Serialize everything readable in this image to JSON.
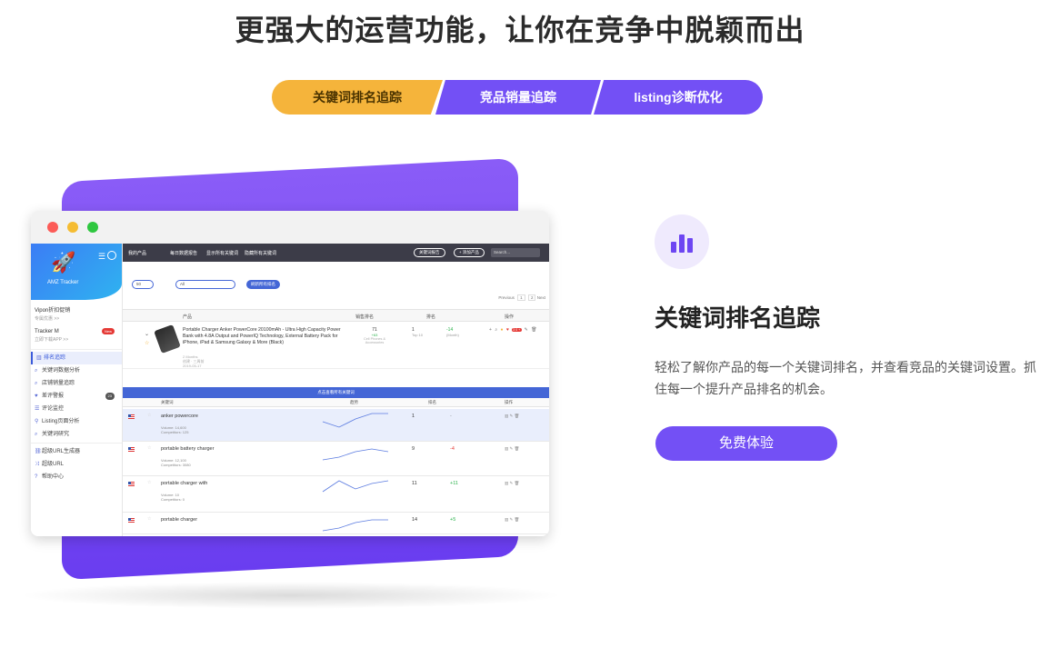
{
  "headline": "更强大的运营功能，让你在竞争中脱颖而出",
  "tabs": [
    {
      "label": "关键词排名追踪"
    },
    {
      "label": "竞品销量追踪"
    },
    {
      "label": "listing诊断优化"
    }
  ],
  "colors": {
    "accent": "#7350f5",
    "active_tab": "#f5b43b",
    "brand_blue": "#3b7df5"
  },
  "app": {
    "brand_name": "AMZ Tracker",
    "menu_icon": "menu-icon",
    "accounts": [
      {
        "name": "Vipon折扣促销",
        "sub": "专属优惠 >>"
      },
      {
        "name": "Tracker M",
        "sub": "立即下载APP >>",
        "badge": "New"
      }
    ],
    "sidebar_items": [
      {
        "label": "排名追踪",
        "icon": "chart-icon",
        "active": true
      },
      {
        "label": "关键词数据分析",
        "icon": "search-icon"
      },
      {
        "label": "店铺销量追踪",
        "icon": "search-icon"
      },
      {
        "label": "差评警报",
        "icon": "heart-icon",
        "count": "23"
      },
      {
        "label": "评论监控",
        "icon": "list-icon"
      },
      {
        "label": "Listing页面分析",
        "icon": "filter-icon"
      },
      {
        "label": "关键词研究",
        "icon": "search-icon"
      },
      {
        "label": "超级URL生成器",
        "icon": "link-icon"
      },
      {
        "label": "超级URL",
        "icon": "shuffle-icon"
      },
      {
        "label": "帮助中心",
        "icon": "help-icon"
      }
    ],
    "topnav": {
      "items": [
        "我的产品",
        "每日数据报告",
        "显示所有关键词",
        "隐藏所有关键词"
      ],
      "buttons": [
        "关键词报告",
        "+ 添加产品"
      ],
      "search_placeholder": "Search..."
    },
    "filters": {
      "page_size": "50",
      "filter_value": "All",
      "action_button": "刷新所有排名"
    },
    "pager": {
      "prev": "Previous",
      "pages": [
        "1",
        "2"
      ],
      "next": "Next"
    },
    "product_table": {
      "headers": [
        "产品",
        "销售排名",
        "排名",
        "操作"
      ],
      "product": {
        "title": "Portable Charger Anker PowerCore 20100mAh - Ultra High Capacity Power Bank with 4.8A Output and PowerIQ Technology, External Battery Pack for iPhone, iPad & Samsung Galaxy & More (Black)",
        "meta": [
          "2 Months",
          "创建 · 三周前",
          "2019-05-17"
        ],
        "sales_rank": "71",
        "sales_rank_change": "+63",
        "sales_category": "Cell Phones & Accessories",
        "kw_rank": "1",
        "kw_rank_sub": "Top 10",
        "kw_change": "-14",
        "kw_change_sub": "(Month)",
        "ops_badge": "30+"
      }
    },
    "keyword_bar": "点击查看所有关键词",
    "keyword_headers": [
      "关键词",
      "趋势",
      "排名",
      "操作"
    ],
    "keywords": [
      {
        "keyword": "anker powercore",
        "volume": "Volume: 14,600",
        "competitors": "Competitors: 125",
        "rank": "1",
        "change": "-",
        "dir": "flat",
        "trend": [
          3,
          5,
          2,
          0,
          0
        ]
      },
      {
        "keyword": "portable battery charger",
        "volume": "Volume: 12,100",
        "competitors": "Competitors: 3080",
        "rank": "9",
        "change": "-4",
        "dir": "down",
        "trend": [
          5,
          4,
          2,
          1,
          2
        ]
      },
      {
        "keyword": "portable charger with",
        "volume": "Volume: 10",
        "competitors": "Competitors: 0",
        "rank": "11",
        "change": "+11",
        "dir": "up",
        "trend": [
          4,
          0,
          3,
          1,
          0
        ]
      },
      {
        "keyword": "portable charger",
        "volume": "",
        "competitors": "",
        "rank": "14",
        "change": "+5",
        "dir": "up",
        "trend": [
          5,
          4,
          2,
          1,
          1
        ]
      }
    ]
  },
  "feature": {
    "icon": "bar-chart-icon",
    "title": "关键词排名追踪",
    "description": "轻松了解你产品的每一个关键词排名，并查看竞品的关键词设置。抓住每一个提升产品排名的机会。",
    "cta": "免费体验"
  }
}
